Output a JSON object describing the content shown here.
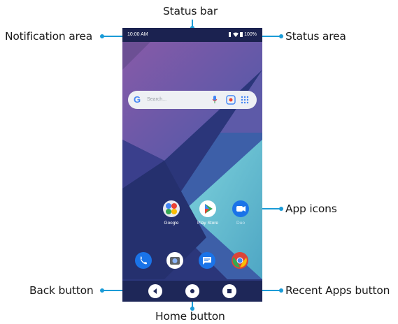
{
  "callouts": {
    "status_bar": "Status bar",
    "notification_area": "Notification area",
    "status_area": "Status area",
    "app_icons": "App icons",
    "back_button": "Back button",
    "home_button": "Home button",
    "recent_apps_button": "Recent Apps button"
  },
  "phone": {
    "time": "10:00 AM",
    "battery": "100%",
    "search_placeholder": "Search...",
    "apps_row1": [
      {
        "label": "Google",
        "icon": "google-folder-icon"
      },
      {
        "label": "Play Store",
        "icon": "play-store-icon"
      },
      {
        "label": "Duo",
        "icon": "duo-icon"
      }
    ],
    "dock": [
      {
        "icon": "phone-icon",
        "color": "#1a73e8"
      },
      {
        "icon": "camera-icon",
        "color": "#ffffff"
      },
      {
        "icon": "messages-icon",
        "color": "#1a73e8"
      },
      {
        "icon": "chrome-icon",
        "color": "#db4437"
      }
    ]
  },
  "colors": {
    "accent": "#1a9bd7",
    "status_bar": "#1b2250",
    "nav_bar": "#1e2758"
  }
}
